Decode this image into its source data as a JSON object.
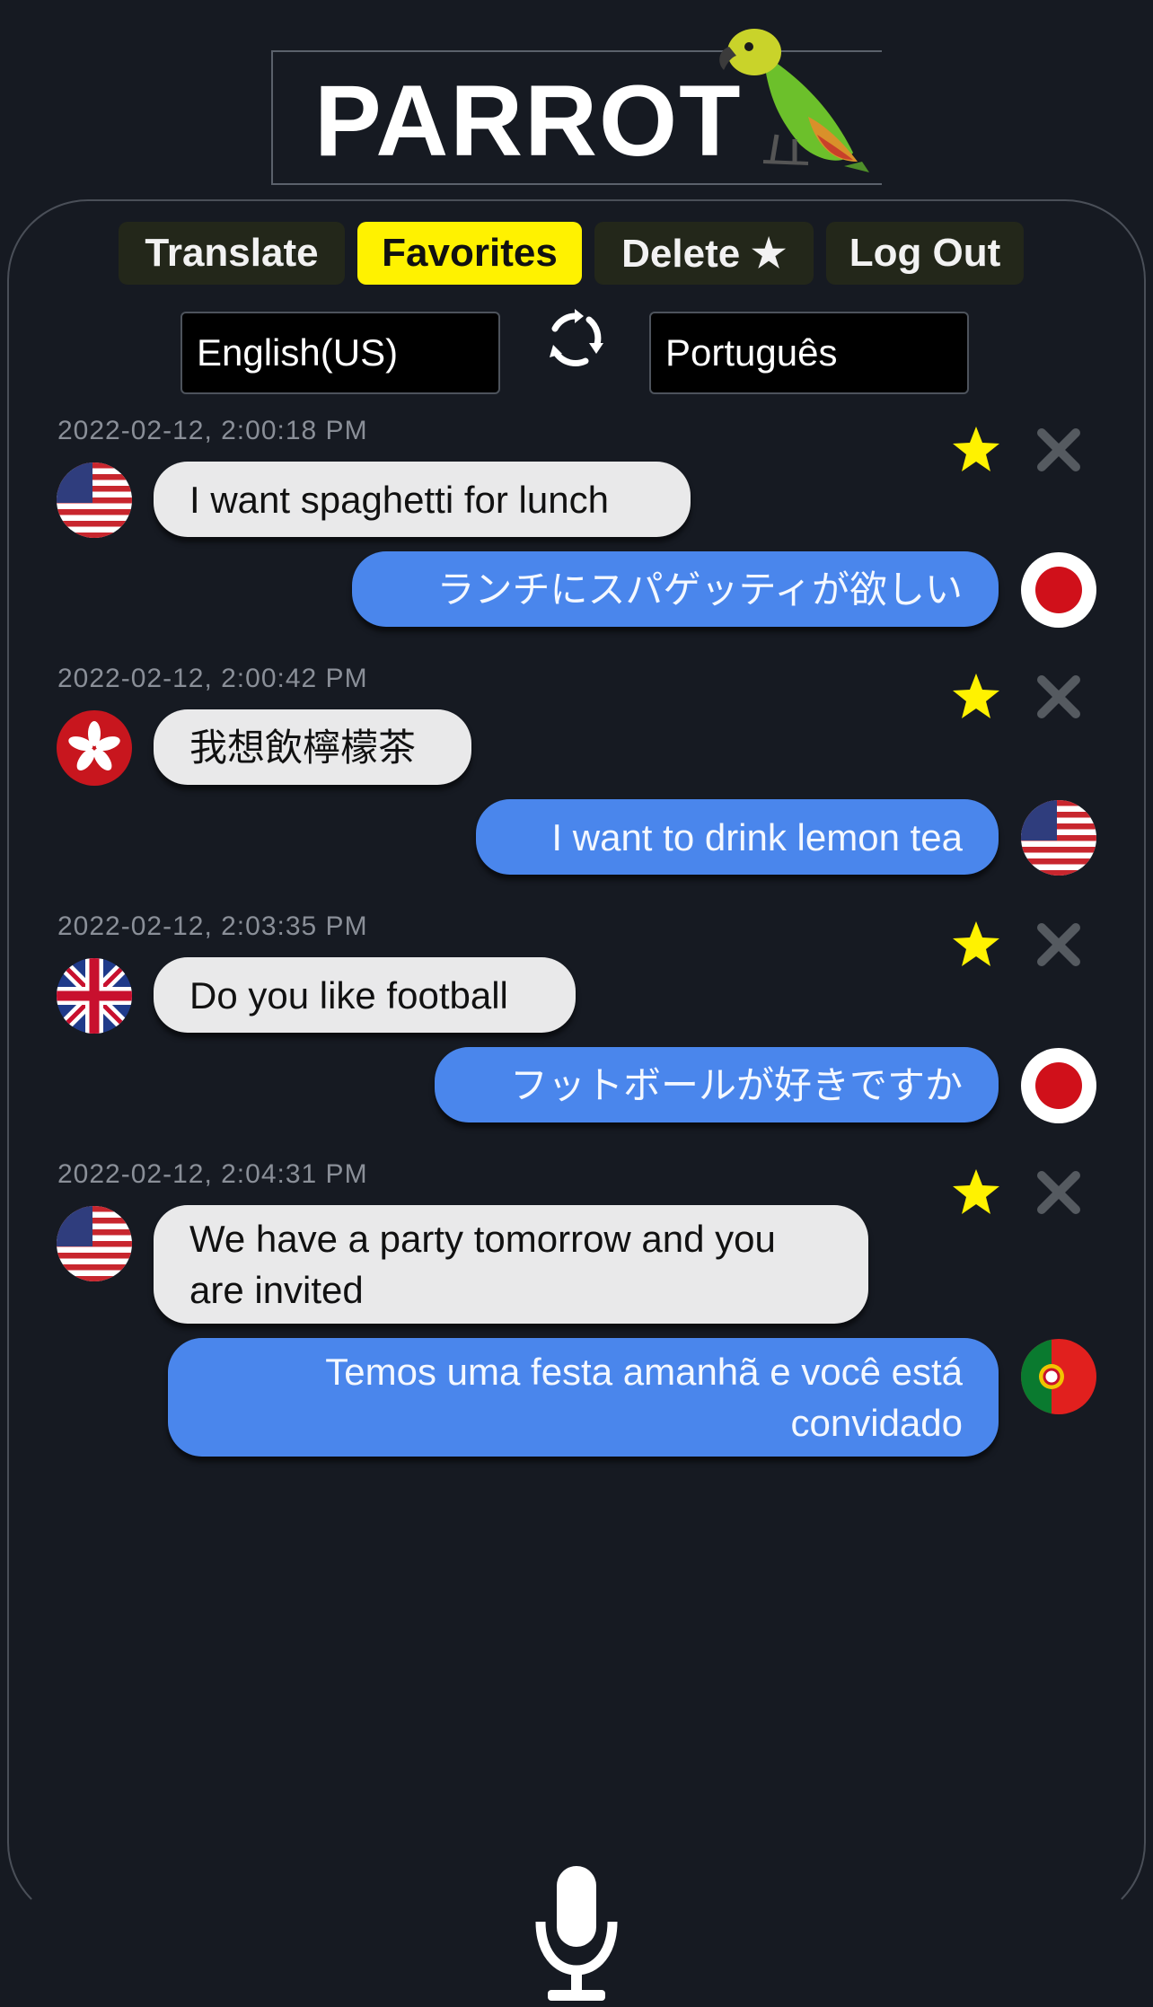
{
  "app": {
    "title": "PARROT"
  },
  "tabs": [
    {
      "label": "Translate",
      "active": false
    },
    {
      "label": "Favorites",
      "active": true
    },
    {
      "label": "Delete ★",
      "active": false
    },
    {
      "label": "Log Out",
      "active": false
    }
  ],
  "languages": {
    "source": "English(US)",
    "target": "Português"
  },
  "colors": {
    "accent": "#fff200",
    "bubble_out": "#4a86ec",
    "bubble_in": "#e9e9ea",
    "background": "#161a22"
  },
  "messages": [
    {
      "timestamp": "2022-02-12, 2:00:18 PM",
      "source_text": "I want spaghetti for lunch",
      "source_flag": "us-flag-icon",
      "translated_text": "ランチにスパゲッティが欲しい",
      "translated_flag": "japan-flag-icon",
      "favorited": true
    },
    {
      "timestamp": "2022-02-12, 2:00:42 PM",
      "source_text": "我想飲檸檬茶",
      "source_flag": "hong-kong-flag-icon",
      "translated_text": "I want to drink lemon tea",
      "translated_flag": "us-flag-icon",
      "favorited": true
    },
    {
      "timestamp": "2022-02-12, 2:03:35 PM",
      "source_text": "Do you like football",
      "source_flag": "uk-flag-icon",
      "translated_text": "フットボールが好きですか",
      "translated_flag": "japan-flag-icon",
      "favorited": true
    },
    {
      "timestamp": "2022-02-12, 2:04:31 PM",
      "source_text": "We have a party tomorrow and you are invited",
      "source_flag": "us-flag-icon",
      "translated_text": "Temos uma festa amanhã e você está convidado",
      "translated_flag": "portugal-flag-icon",
      "favorited": true
    }
  ]
}
